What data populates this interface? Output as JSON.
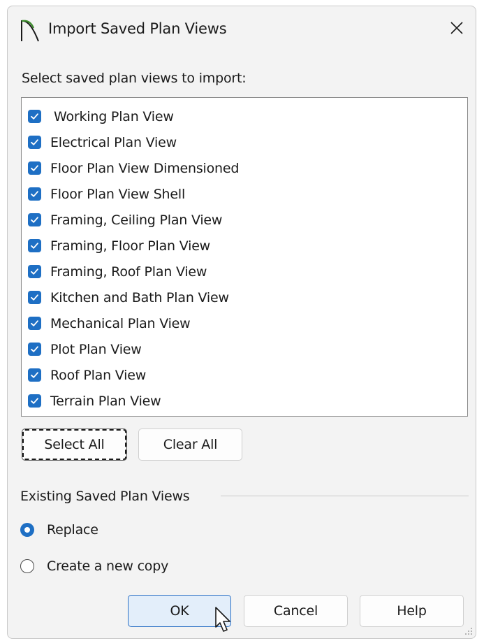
{
  "window": {
    "title": "Import Saved Plan Views",
    "close_glyph": "✕"
  },
  "instruction": "Select saved plan views to import:",
  "plan_views": [
    {
      "label": "Working Plan View",
      "checked": true
    },
    {
      "label": "Electrical Plan View",
      "checked": true
    },
    {
      "label": "Floor Plan View Dimensioned",
      "checked": true
    },
    {
      "label": "Floor Plan View Shell",
      "checked": true
    },
    {
      "label": "Framing, Ceiling Plan View",
      "checked": true
    },
    {
      "label": "Framing, Floor Plan View",
      "checked": true
    },
    {
      "label": "Framing, Roof Plan View",
      "checked": true
    },
    {
      "label": "Kitchen and Bath Plan View",
      "checked": true
    },
    {
      "label": "Mechanical Plan View",
      "checked": true
    },
    {
      "label": "Plot Plan View",
      "checked": true
    },
    {
      "label": "Roof Plan View",
      "checked": true
    },
    {
      "label": "Terrain Plan View",
      "checked": true
    }
  ],
  "buttons": {
    "select_all": "Select All",
    "clear_all": "Clear All",
    "ok": "OK",
    "cancel": "Cancel",
    "help": "Help"
  },
  "existing_group": {
    "label": "Existing Saved Plan Views",
    "options": [
      {
        "label": "Replace",
        "selected": true
      },
      {
        "label": "Create a new copy",
        "selected": false
      }
    ]
  },
  "colors": {
    "accent": "#1e6fc4",
    "dialog_bg": "#f3f3f3",
    "list_bg": "#ffffff",
    "ok_bg": "#e3eefa",
    "app_icon_green": "#3a8a2a"
  },
  "icons": {
    "app": "arch-app-icon",
    "close": "close-icon",
    "check": "checkmark-icon",
    "cursor": "mouse-pointer-icon",
    "grip": "resize-grip-icon"
  }
}
